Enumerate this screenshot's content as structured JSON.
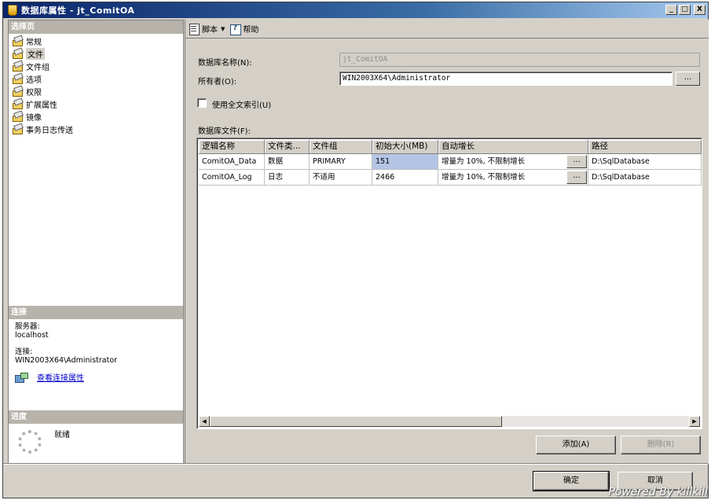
{
  "window": {
    "title": "数据库属性 - jt_ComitOA",
    "minimize_glyph": "_",
    "maximize_glyph": "□",
    "close_glyph": "X"
  },
  "left": {
    "pages_header": "选择页",
    "pages": [
      {
        "label": "常规"
      },
      {
        "label": "文件"
      },
      {
        "label": "文件组"
      },
      {
        "label": "选项"
      },
      {
        "label": "权限"
      },
      {
        "label": "扩展属性"
      },
      {
        "label": "镜像"
      },
      {
        "label": "事务日志传送"
      }
    ],
    "connection_header": "连接",
    "server_label": "服务器:",
    "server_value": "localhost",
    "connection_label": "连接:",
    "connection_value": "WIN2003X64\\Administrator",
    "view_connection_link": "查看连接属性",
    "progress_header": "进度",
    "progress_status": "就绪"
  },
  "toolbar": {
    "script_label": "脚本",
    "script_caret": "▼",
    "help_label": "帮助"
  },
  "form": {
    "db_name_label": "数据库名称(N):",
    "db_name_value": "jt_ComitOA",
    "owner_label": "所有者(O):",
    "owner_value": "WIN2003X64\\Administrator",
    "owner_browse": "...",
    "fulltext_label": "使用全文索引(U)",
    "db_files_label": "数据库文件(F):"
  },
  "grid": {
    "columns": [
      "逻辑名称",
      "文件类...",
      "文件组",
      "初始大小(MB)",
      "自动增长",
      "路径"
    ],
    "rows": [
      {
        "name": "ComitOA_Data",
        "type": "数据",
        "group": "PRIMARY",
        "size": "151",
        "growth": "增量为 10%, 不限制增长",
        "btn": "...",
        "path": "D:\\SqlDatabase"
      },
      {
        "name": "ComitOA_Log",
        "type": "日志",
        "group": "不适用",
        "size": "2466",
        "growth": "增量为 10%, 不限制增长",
        "btn": "...",
        "path": "D:\\SqlDatabase"
      }
    ],
    "scroll_left": "◀",
    "scroll_right": "▶"
  },
  "buttons": {
    "add": "添加(A)",
    "remove": "删除(R)",
    "ok": "确定",
    "cancel": "取消"
  },
  "watermark": "Powered By killkill"
}
